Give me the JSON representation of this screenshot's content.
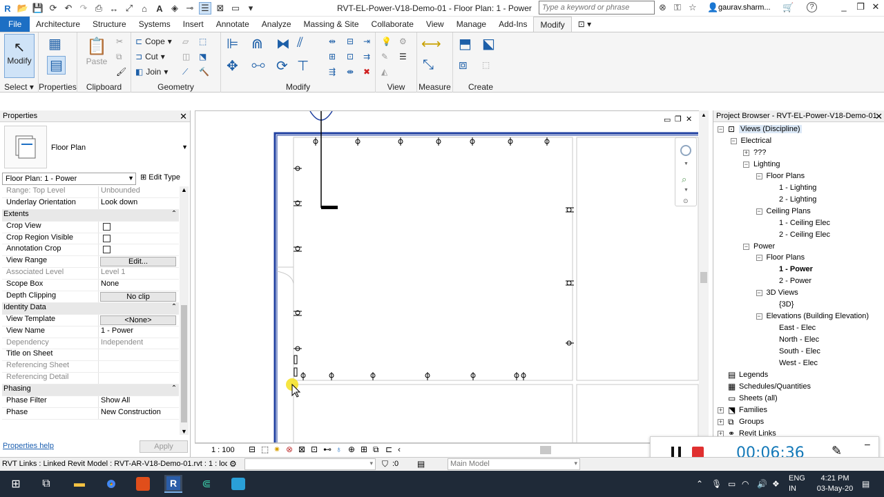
{
  "window": {
    "title": "RVT-EL-Power-V18-Demo-01 - Floor Plan: 1 - Power",
    "search_placeholder": "Type a keyword or phrase",
    "user": "gaurav.sharm...",
    "glyphs": {
      "minimize": "_",
      "restore": "❐",
      "close": "✕",
      "help": "?",
      "sign_in": "☆",
      "cart": "🛒"
    }
  },
  "ribbon_tabs": [
    "File",
    "Architecture",
    "Structure",
    "Systems",
    "Insert",
    "Annotate",
    "Analyze",
    "Massing & Site",
    "Collaborate",
    "View",
    "Manage",
    "Add-Ins",
    "Modify"
  ],
  "active_tab": "Modify",
  "ribbon": {
    "select": {
      "button": "Modify",
      "label": "Select"
    },
    "properties": {
      "label": "Properties"
    },
    "clipboard": {
      "paste": "Paste",
      "label": "Clipboard"
    },
    "geometry": {
      "cope": "Cope",
      "cut": "Cut",
      "join": "Join",
      "label": "Geometry"
    },
    "modify_label": "Modify",
    "view_label": "View",
    "measure_label": "Measure",
    "create_label": "Create"
  },
  "properties": {
    "title": "Properties",
    "close_glyph": "✕",
    "type_name": "Floor Plan",
    "instance_selector": "Floor Plan: 1 - Power",
    "edit_type": "Edit Type",
    "rows": [
      {
        "kind": "prop",
        "name": "Range: Top Level",
        "value": "Unbounded",
        "readonly": true
      },
      {
        "kind": "prop",
        "name": "Underlay Orientation",
        "value": "Look down"
      },
      {
        "kind": "group",
        "name": "Extents"
      },
      {
        "kind": "check",
        "name": "Crop View"
      },
      {
        "kind": "check",
        "name": "Crop Region Visible"
      },
      {
        "kind": "check",
        "name": "Annotation Crop"
      },
      {
        "kind": "button",
        "name": "View Range",
        "value": "Edit..."
      },
      {
        "kind": "prop",
        "name": "Associated Level",
        "value": "Level 1",
        "readonly": true
      },
      {
        "kind": "prop",
        "name": "Scope Box",
        "value": "None"
      },
      {
        "kind": "button",
        "name": "Depth Clipping",
        "value": "No clip"
      },
      {
        "kind": "group",
        "name": "Identity Data"
      },
      {
        "kind": "button",
        "name": "View Template",
        "value": "<None>"
      },
      {
        "kind": "prop",
        "name": "View Name",
        "value": "1 - Power"
      },
      {
        "kind": "prop",
        "name": "Dependency",
        "value": "Independent",
        "readonly": true
      },
      {
        "kind": "prop",
        "name": "Title on Sheet",
        "value": ""
      },
      {
        "kind": "prop",
        "name": "Referencing Sheet",
        "value": "",
        "readonly": true
      },
      {
        "kind": "prop",
        "name": "Referencing Detail",
        "value": "",
        "readonly": true
      },
      {
        "kind": "group",
        "name": "Phasing"
      },
      {
        "kind": "prop",
        "name": "Phase Filter",
        "value": "Show All"
      },
      {
        "kind": "prop",
        "name": "Phase",
        "value": "New Construction"
      }
    ],
    "help_link": "Properties help",
    "apply": "Apply"
  },
  "view": {
    "scale": "1 : 100"
  },
  "browser": {
    "title": "Project Browser - RVT-EL-Power-V18-Demo-01",
    "nodes": [
      {
        "label": "Views (Discipline)",
        "depth": 0,
        "toggle": "−",
        "icon": "views"
      },
      {
        "label": "Electrical",
        "depth": 1,
        "toggle": "−"
      },
      {
        "label": "???",
        "depth": 2,
        "toggle": "+"
      },
      {
        "label": "Lighting",
        "depth": 2,
        "toggle": "−"
      },
      {
        "label": "Floor Plans",
        "depth": 3,
        "toggle": "−"
      },
      {
        "label": "1 - Lighting",
        "depth": 4
      },
      {
        "label": "2 - Lighting",
        "depth": 4
      },
      {
        "label": "Ceiling Plans",
        "depth": 3,
        "toggle": "−"
      },
      {
        "label": "1 - Ceiling Elec",
        "depth": 4
      },
      {
        "label": "2 - Ceiling Elec",
        "depth": 4
      },
      {
        "label": "Power",
        "depth": 2,
        "toggle": "−"
      },
      {
        "label": "Floor Plans",
        "depth": 3,
        "toggle": "−"
      },
      {
        "label": "1 - Power",
        "depth": 4,
        "bold": true
      },
      {
        "label": "2 - Power",
        "depth": 4
      },
      {
        "label": "3D Views",
        "depth": 3,
        "toggle": "−"
      },
      {
        "label": "{3D}",
        "depth": 4
      },
      {
        "label": "Elevations (Building Elevation)",
        "depth": 3,
        "toggle": "−"
      },
      {
        "label": "East - Elec",
        "depth": 4
      },
      {
        "label": "North - Elec",
        "depth": 4
      },
      {
        "label": "South - Elec",
        "depth": 4
      },
      {
        "label": "West - Elec",
        "depth": 4
      },
      {
        "label": "Legends",
        "depth": 0,
        "icon": "legend"
      },
      {
        "label": "Schedules/Quantities",
        "depth": 0,
        "icon": "schedule"
      },
      {
        "label": "Sheets (all)",
        "depth": 0,
        "icon": "sheet"
      },
      {
        "label": "Families",
        "depth": 0,
        "toggle": "+",
        "icon": "family"
      },
      {
        "label": "Groups",
        "depth": 0,
        "toggle": "+",
        "icon": "group"
      },
      {
        "label": "Revit Links",
        "depth": 0,
        "toggle": "+",
        "icon": "link"
      }
    ]
  },
  "recorder": {
    "time": "00:06:36"
  },
  "status": {
    "text": "RVT Links : Linked Revit Model : RVT-AR-V18-Demo-01.rvt : 1 : loc",
    "filter_count": ":0",
    "model": "Main Model"
  },
  "taskbar": {
    "lang": "ENG",
    "region": "IN",
    "time": "4:21 PM",
    "date": "03-May-20"
  },
  "colors": {
    "accent": "#1d6fc4",
    "wall": "#1f3fa0",
    "taskbar": "#1f2a38",
    "recorder_time": "#1479b8",
    "record": "#e03030"
  }
}
